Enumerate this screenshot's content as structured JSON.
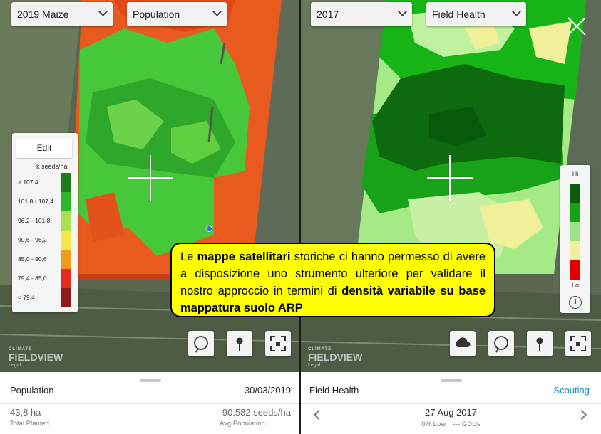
{
  "left": {
    "season_select": "2019 Maize",
    "layer_select": "Population",
    "legend": {
      "edit_label": "Edit",
      "unit": "k seeds/ha",
      "rows": [
        {
          "label": "> 107,4",
          "color": "#1e7a1e"
        },
        {
          "label": "101,8 - 107,4",
          "color": "#2eb52e"
        },
        {
          "label": "96,2 - 101,8",
          "color": "#a8e050"
        },
        {
          "label": "90,6 - 96,2",
          "color": "#f2e94a"
        },
        {
          "label": "85,0 - 90,6",
          "color": "#f29a1a"
        },
        {
          "label": "79,4 - 85,0",
          "color": "#e52b1e"
        },
        {
          "label": "< 79,4",
          "color": "#8e1a1a"
        }
      ]
    },
    "tools": [
      "lasso-icon",
      "pin-icon",
      "fullscreen-icon"
    ],
    "watermark": {
      "line1": "CLIMATE",
      "line2": "FIELDVIEW",
      "line3": "Legal"
    },
    "bottom": {
      "title": "Population",
      "date": "30/03/2019",
      "area_value": "43,8 ha",
      "area_label": "Total Planted",
      "pop_value": "90.582 seeds/ha",
      "pop_label": "Avg Population"
    }
  },
  "right": {
    "season_select": "2017",
    "layer_select": "Field Health",
    "legend": {
      "hi": "Hi",
      "lo": "Lo",
      "colors": [
        "#0b5d0b",
        "#14a314",
        "#9ee38a",
        "#f2f09a",
        "#e00000"
      ],
      "info_icon": "info-icon"
    },
    "tools": [
      "cloud-icon",
      "lasso-icon",
      "pin-icon",
      "fullscreen-icon"
    ],
    "watermark": {
      "line1": "CLIMATE",
      "line2": "FIELDVIEW",
      "line3": "Legal"
    },
    "bottom": {
      "title": "Field Health",
      "scouting": "Scouting",
      "date": "27 Aug 2017",
      "pct_low": "0% Low",
      "gdus": "--- GDUs"
    }
  },
  "callout": {
    "p1": "Le ",
    "b1": "mappe satellitari",
    "p2": " storiche ci hanno permesso di avere a disposizione uno strumento ulteriore per validare il nostro approccio in termini di ",
    "b2": "densità variabile su base mappatura suolo ARP"
  },
  "colors": {
    "accent": "#1a8ad4",
    "callout_bg": "#ffff00"
  }
}
